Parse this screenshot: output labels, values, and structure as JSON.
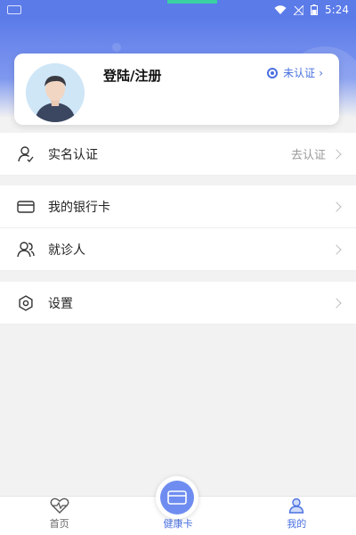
{
  "status_bar": {
    "time": "5:24"
  },
  "profile": {
    "login_label": "登陆/注册",
    "verify_status": "未认证"
  },
  "menu_group_1": {
    "real_name": {
      "label": "实名认证",
      "value": "去认证"
    }
  },
  "menu_group_2": {
    "bank_card": {
      "label": "我的银行卡"
    },
    "patient": {
      "label": "就诊人"
    }
  },
  "menu_group_3": {
    "settings": {
      "label": "设置"
    }
  },
  "bottom_nav": {
    "home": "首页",
    "health_card": "健康卡",
    "mine": "我的"
  },
  "colors": {
    "accent": "#4a70e0",
    "hero": "#5d7ce9"
  }
}
